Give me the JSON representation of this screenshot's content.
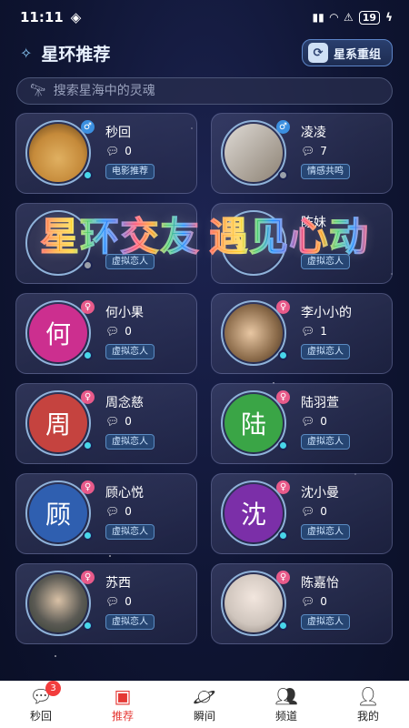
{
  "status": {
    "time": "11:11",
    "battery": "19"
  },
  "header": {
    "title": "星环推荐",
    "regroup_label": "星系重组"
  },
  "search": {
    "placeholder": "搜索星海中的灵魂"
  },
  "banner": {
    "part1": "星环交友",
    "part2": "遇见心动"
  },
  "cards": [
    {
      "name": "秒回",
      "messages": "0",
      "tag": "电影推荐",
      "gender": "male",
      "online": true,
      "avatar_type": "photo",
      "avatar_icon": "dog-photo"
    },
    {
      "name": "凌凌",
      "messages": "7",
      "tag": "情感共鸣",
      "gender": "male",
      "online": false,
      "avatar_type": "photo",
      "avatar_icon": "couple-photo"
    },
    {
      "name": "",
      "messages": "",
      "tag": "虚拟恋人",
      "gender": "",
      "online": false,
      "avatar_type": "hidden"
    },
    {
      "name": "陈妹",
      "messages": "",
      "tag": "虚拟恋人",
      "gender": "",
      "online": false,
      "avatar_type": "hidden"
    },
    {
      "name": "何小果",
      "messages": "0",
      "tag": "虚拟恋人",
      "gender": "female",
      "online": true,
      "avatar_type": "char",
      "char": "何",
      "color": "#cc2f8f"
    },
    {
      "name": "李小小的",
      "messages": "1",
      "tag": "虚拟恋人",
      "gender": "female",
      "online": true,
      "avatar_type": "photo",
      "avatar_icon": "girl-photo"
    },
    {
      "name": "周念慈",
      "messages": "0",
      "tag": "虚拟恋人",
      "gender": "female",
      "online": true,
      "avatar_type": "char",
      "char": "周",
      "color": "#c5433f"
    },
    {
      "name": "陆羽萱",
      "messages": "0",
      "tag": "虚拟恋人",
      "gender": "female",
      "online": true,
      "avatar_type": "char",
      "char": "陆",
      "color": "#3aa546"
    },
    {
      "name": "顾心悦",
      "messages": "0",
      "tag": "虚拟恋人",
      "gender": "female",
      "online": true,
      "avatar_type": "char",
      "char": "顾",
      "color": "#2f5fb0"
    },
    {
      "name": "沈小曼",
      "messages": "0",
      "tag": "虚拟恋人",
      "gender": "female",
      "online": true,
      "avatar_type": "char",
      "char": "沈",
      "color": "#7b2fa8"
    },
    {
      "name": "苏西",
      "messages": "0",
      "tag": "虚拟恋人",
      "gender": "female",
      "online": true,
      "avatar_type": "photo",
      "avatar_icon": "girl-photo"
    },
    {
      "name": "陈嘉怡",
      "messages": "0",
      "tag": "虚拟恋人",
      "gender": "female",
      "online": true,
      "avatar_type": "photo",
      "avatar_icon": "girl-photo"
    }
  ],
  "tabs": [
    {
      "label": "秒回",
      "icon": "chat-icon",
      "badge": "3"
    },
    {
      "label": "推荐",
      "icon": "recommend-icon",
      "active": true
    },
    {
      "label": "瞬间",
      "icon": "planet-icon"
    },
    {
      "label": "频道",
      "icon": "people-icon"
    },
    {
      "label": "我的",
      "icon": "user-icon"
    }
  ],
  "colors": {
    "accent": "#e53935",
    "online": "#48d6ea",
    "male": "#3b8fe0",
    "female": "#e85a8a"
  }
}
